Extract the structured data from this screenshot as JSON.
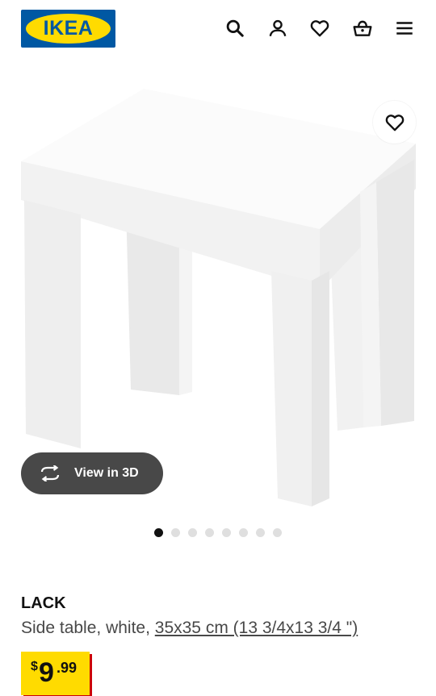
{
  "header": {
    "logo_text": "IKEA",
    "logo_reg": "®",
    "icons": [
      "search-icon",
      "account-icon",
      "heart-icon",
      "shopping-bag-icon",
      "menu-icon"
    ]
  },
  "media": {
    "view3d_label": "View in 3D",
    "image_count": 8,
    "active_image": 1
  },
  "product": {
    "name": "LACK",
    "description": "Side table, white, ",
    "size": "35x35 cm (13 3/4x13 3/4 \")",
    "price": {
      "currency": "$",
      "integer": "9",
      "decimal": ".99"
    }
  },
  "colors": {
    "ikea_blue": "#0058a3",
    "ikea_yellow": "#ffdb00",
    "price_shadow": "#cc0008",
    "pill_bg": "#484848"
  }
}
